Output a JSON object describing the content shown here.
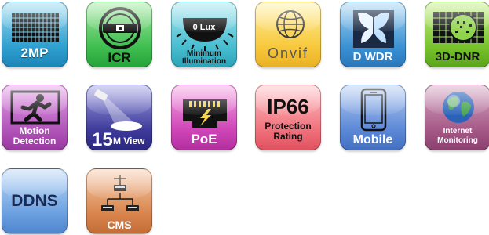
{
  "features": [
    {
      "id": "2mp",
      "label": "2MP",
      "icon": "grid-sensor-icon"
    },
    {
      "id": "icr",
      "label": "ICR",
      "icon": "ir-cut-filter-icon"
    },
    {
      "id": "min",
      "label_lines": [
        "Minimum",
        "Illumination"
      ],
      "badge": "0 Lux",
      "icon": "dome-light-icon"
    },
    {
      "id": "onvif",
      "label": "Onvif",
      "icon": "globe-network-icon"
    },
    {
      "id": "dwdr",
      "label": "D WDR",
      "icon": "butterfly-icon"
    },
    {
      "id": "3dnr",
      "label": "3D-DNR",
      "icon": "noise-grid-icon"
    },
    {
      "id": "motion",
      "label_lines": [
        "Motion",
        "Detection"
      ],
      "icon": "running-man-icon"
    },
    {
      "id": "15m",
      "label_big": "15",
      "label_small": "M View",
      "icon": "spotlight-camera-icon"
    },
    {
      "id": "poe",
      "label": "PoE",
      "icon": "ethernet-port-icon"
    },
    {
      "id": "ip66",
      "label_big": "IP66",
      "label_lines": [
        "Protection",
        "Rating"
      ],
      "icon": "rating-text-icon"
    },
    {
      "id": "mobile",
      "label": "Mobile",
      "icon": "smartphone-icon"
    },
    {
      "id": "inet",
      "label_lines": [
        "Internet",
        "Monitoring"
      ],
      "icon": "earth-globe-icon"
    },
    {
      "id": "ddns",
      "label": "DDNS",
      "icon": "text-icon"
    },
    {
      "id": "cms",
      "label": "CMS",
      "icon": "network-topology-icon"
    }
  ],
  "colors": {
    "2mp": "#2f9fcf",
    "icr": "#3fbe50",
    "min": "#48bdd0",
    "onvif": "#f7c83a",
    "dwdr": "#3a90d2",
    "3dnr": "#78c22c",
    "motion": "#b153b9",
    "15m": "#3d3a9a",
    "poe": "#cf45b8",
    "ip66": "#f0707b",
    "mobile": "#5b87d6",
    "inet": "#a45886",
    "ddns": "#6a9fe0",
    "cms": "#d8844c"
  }
}
